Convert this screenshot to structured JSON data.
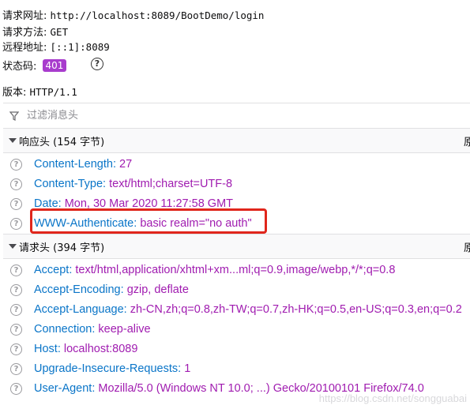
{
  "summary": {
    "request_url_label": "请求网址:",
    "request_url": "http://localhost:8089/BootDemo/login",
    "method_label": "请求方法:",
    "method": "GET",
    "remote_label": "远程地址:",
    "remote": "[::1]:8089",
    "status_label": "状态码:",
    "status_code": "401",
    "version_label": "版本:",
    "version": "HTTP/1.1"
  },
  "filter": {
    "placeholder": "过滤消息头"
  },
  "response_headers": {
    "title": "响应头 (154 字节)",
    "raw_toggle": "原",
    "items": [
      {
        "name": "Content-Length:",
        "value": "27"
      },
      {
        "name": "Content-Type:",
        "value": "text/html;charset=UTF-8"
      },
      {
        "name": "Date:",
        "value": "Mon, 30 Mar 2020 11:27:58 GMT"
      },
      {
        "name": "WWW-Authenticate:",
        "value": "basic realm=\"no auth\""
      }
    ]
  },
  "request_headers": {
    "title": "请求头 (394 字节)",
    "raw_toggle": "原",
    "items": [
      {
        "name": "Accept:",
        "value": "text/html,application/xhtml+xm...ml;q=0.9,image/webp,*/*;q=0.8"
      },
      {
        "name": "Accept-Encoding:",
        "value": "gzip, deflate"
      },
      {
        "name": "Accept-Language:",
        "value": "zh-CN,zh;q=0.8,zh-TW;q=0.7,zh-HK;q=0.5,en-US;q=0.3,en;q=0.2"
      },
      {
        "name": "Connection:",
        "value": "keep-alive"
      },
      {
        "name": "Host:",
        "value": "localhost:8089"
      },
      {
        "name": "Upgrade-Insecure-Requests:",
        "value": "1"
      },
      {
        "name": "User-Agent:",
        "value": "Mozilla/5.0 (Windows NT 10.0; ...) Gecko/20100101 Firefox/74.0"
      }
    ]
  },
  "watermark": "https://blog.csdn.net/songguabai",
  "colors": {
    "status_badge": "#a83ccd",
    "header_name": "#0a75c8",
    "header_value": "#a01cb0",
    "highlight": "#e0261c"
  }
}
